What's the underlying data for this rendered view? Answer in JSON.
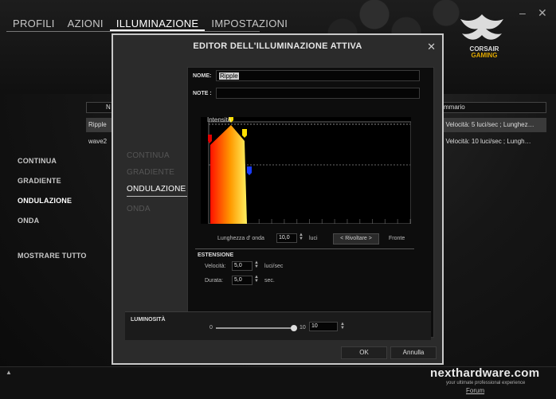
{
  "topnav": {
    "tabs": [
      "PROFILI",
      "AZIONI",
      "ILLUMINAZIONE",
      "IMPOSTAZIONI"
    ],
    "active_index": 2
  },
  "window": {
    "minimize": "–",
    "close": "✕"
  },
  "logo": {
    "line1": "CORSAIR",
    "line2": "GAMING"
  },
  "left_menu": {
    "items": [
      "CONTINUA",
      "GRADIENTE",
      "ONDULAZIONE",
      "ONDA"
    ],
    "active": "ONDULAZIONE",
    "show_all": "MOSTRARE TUTTO"
  },
  "bg_table": {
    "col_name": "N",
    "col_summary": "mmario",
    "rows": [
      {
        "name": "Ripple",
        "summary": "; Velocità: 5 luci/sec ; Lunghez…",
        "selected": true
      },
      {
        "name": "wave2",
        "summary": "; Velocità: 10 luci/sec ; Lungh…",
        "selected": false
      }
    ]
  },
  "modal": {
    "title": "EDITOR DELL'ILLUMINAZIONE ATTIVA",
    "close": "✕",
    "name_label": "NOME:",
    "name_value": "Ripple",
    "notes_label": "NOTE :",
    "notes_value": "",
    "menu": [
      "CONTINUA",
      "GRADIENTE",
      "ONDULAZIONE",
      "ONDA"
    ],
    "menu_active": "ONDULAZIONE",
    "graph": {
      "label": "Intensità",
      "colors": {
        "left": "#ff2000",
        "mid": "#ff9a00",
        "right": "#ffee55"
      }
    },
    "wave": {
      "label": "Lunghezza d' onda",
      "value": "10,0",
      "unit": "luci",
      "reverse_button": "< Rivoltare >",
      "front_label": "Fronte"
    },
    "extension": {
      "title": "ESTENSIONE",
      "speed_label": "Velocità:",
      "speed_value": "5,0",
      "speed_unit": "luci/sec",
      "duration_label": "Durata:",
      "duration_value": "5,0",
      "duration_unit": "sec."
    },
    "brightness": {
      "label": "LUMINOSITÀ",
      "min": "0",
      "max": "10",
      "value": "10",
      "level": 1.0
    },
    "ok": "OK",
    "cancel": "Annulla"
  },
  "watermark": {
    "text": "nexthardware.com",
    "sub": "your ultimate professional experience",
    "forum": "Forum"
  },
  "colors": {
    "accent": "#ffffff",
    "graph_grid": "#444444",
    "marker_yellow": "#ffe000",
    "marker_red": "#e00000",
    "marker_blue": "#1a3cff"
  }
}
